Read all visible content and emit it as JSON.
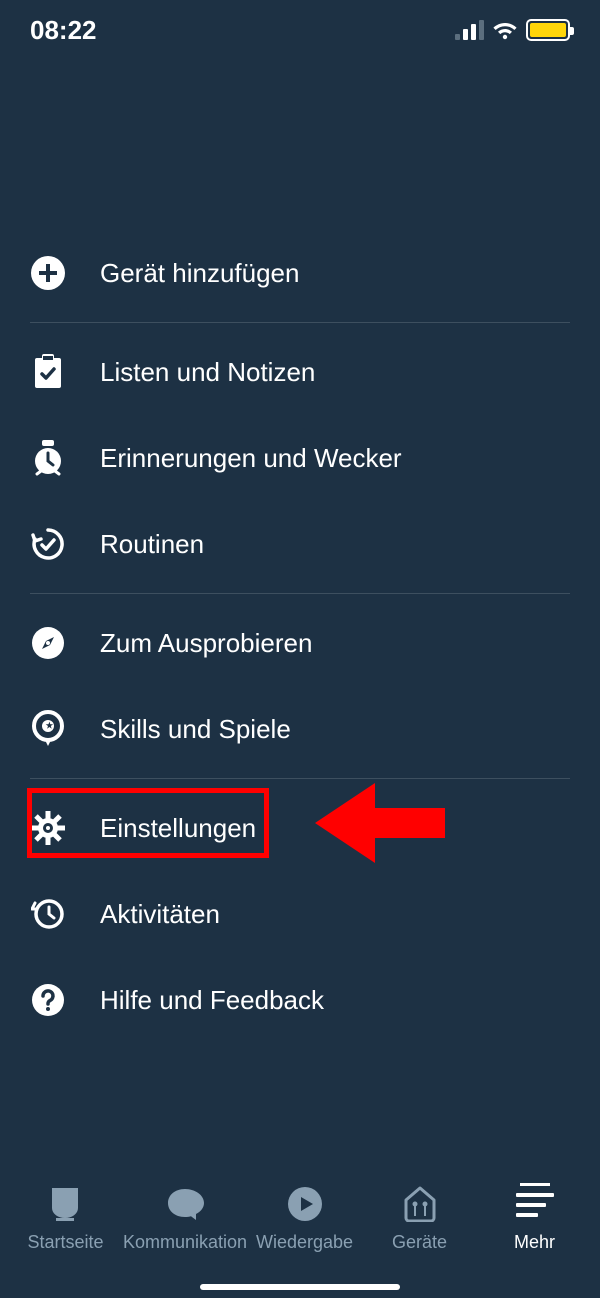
{
  "status": {
    "time": "08:22"
  },
  "menu": {
    "addDevice": "Gerät hinzufügen",
    "lists": "Listen und Notizen",
    "reminders": "Erinnerungen und Wecker",
    "routines": "Routinen",
    "tryout": "Zum Ausprobieren",
    "skills": "Skills und Spiele",
    "settings": "Einstellungen",
    "activity": "Aktivitäten",
    "help": "Hilfe und Feedback"
  },
  "nav": {
    "home": "Startseite",
    "comm": "Kommunikation",
    "play": "Wiedergabe",
    "devices": "Geräte",
    "more": "Mehr"
  },
  "annotation": {
    "highlighted_item": "settings"
  }
}
